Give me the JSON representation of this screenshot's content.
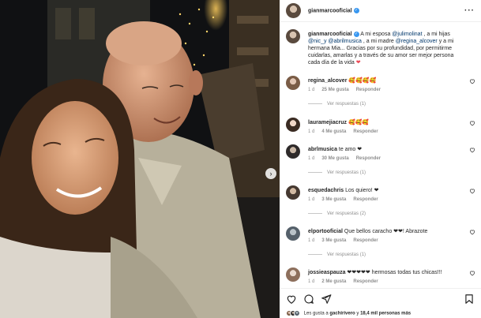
{
  "post": {
    "username": "gianmarcooficial",
    "caption_parts": [
      "A mi esposa ",
      "@julimolinat",
      " , a mi hijas ",
      "@nic_y",
      " ",
      "@abrilmusica",
      " , a mi madre ",
      "@regina_alcover",
      " y a mi hermana Mia... Gracias por su profundidad, por permitirme cuidarlas, amarlas y a través de su amor ser mejor persona cada día de la vida "
    ],
    "caption_heart": "❤"
  },
  "ui": {
    "reply_label": "Responder",
    "more_icon": "more-icon"
  },
  "comments": [
    {
      "user": "regina_alcover",
      "text": "🥰🥰🥰🥰",
      "age": "1 d",
      "likes": "25 Me gusta",
      "replies": "Ver respuestas (1)"
    },
    {
      "user": "lauramejiacruz",
      "text": "🥰🥰🥰",
      "age": "1 d",
      "likes": "4 Me gusta",
      "replies": ""
    },
    {
      "user": "abrlmusica",
      "text": "te amo ❤",
      "age": "1 d",
      "likes": "30 Me gusta",
      "replies": "Ver respuestas (1)"
    },
    {
      "user": "esquedachris",
      "text": "Los quiero! ❤",
      "age": "1 d",
      "likes": "3 Me gusta",
      "replies": "Ver respuestas (2)"
    },
    {
      "user": "elportooficial",
      "text": "Que bellos caracho ❤❤! Abrazote",
      "age": "1 d",
      "likes": "3 Me gusta",
      "replies": "Ver respuestas (1)"
    },
    {
      "user": "jossieaspauza",
      "text": "❤❤❤❤❤ hermosas todas tus chicas!!!",
      "age": "1 d",
      "likes": "2 Me gusta",
      "replies": ""
    }
  ],
  "likes_line": {
    "prefix": "Les gusta a ",
    "user": "gachirivero",
    "middle": " y ",
    "count": "18,4 mil personas más"
  },
  "colors": {
    "accent": "#3897f0",
    "heart": "#ed4956",
    "mention": "#00376b",
    "secondary": "#8e8e8e"
  }
}
